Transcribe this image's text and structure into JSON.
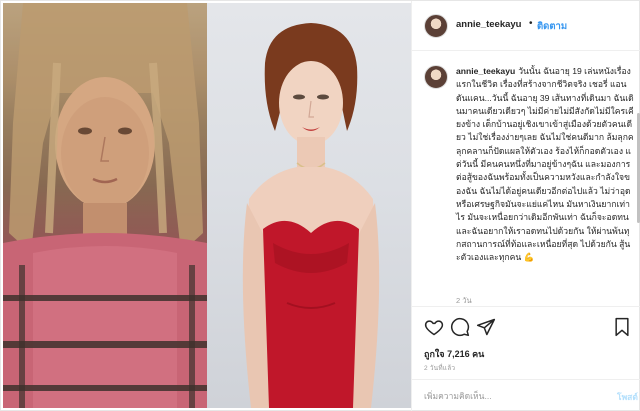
{
  "post": {
    "username": "annie_teekayu",
    "follow_separator": "•",
    "follow_label": "ติดตาม",
    "caption_username": "annie_teekayu",
    "caption_text": "วันนั้น ฉันอายุ 19 เล่นหนังเรื่องแรกในชีวิต เรื่องที่สร้างจากชีวิตจริง เชอรี่ แอน ดันแคน...วันนี้ ฉันอายุ 39 เส้นทางที่เดินมา ฉันเดินมาคนเดียวเดียวๆ ไม่มีค่ายไม่มีสังกัดไม่มีใครเคียงข้าง เด็กบ้านอยู่เชิงเขาเข้าสู่เมืองด้วยตัวคนเดียว ไม่ใช่เรื่องง่ายๆเลย ฉันไม่ใช่คนดีมาก ล้มลุกคลุกคลานก็ปัดแผลให้ตัวเอง ร้องไห้ก็กอดตัวเอง แต่วันนี้ มีคนคนหนึ่งที่มาอยู่ข้างๆฉัน และมองการต่อสู้ของฉันพร้อมทั้งเป็นความหวังและกำลังใจของฉัน ฉันไม่ได้อยู่คนเดียวอีกต่อไปแล้ว ไม่ว่าอุดหรือเศรษฐกิจมันจะแย่แค่ไหน มันหาเงินยากเท่าไร มันจะเหนื่อยกว่าเดิมอีกพันเท่า ฉันก็จะอดทน และฉันอยากให้เราอดทนไปด้วยกัน ให้ผ่านพ้นทุกสถานการณ์ที่ท้อและเหนื่อยที่สุด ไปด้วยกัน สู้นะตัวเองและทุกคน 💪",
    "caption_time": "2 วัน",
    "likes": "ถูกใจ 7,216 คน",
    "post_time": "2 วันที่แล้ว",
    "comment_placeholder": "เพิ่มความคิดเห็น...",
    "comment_post_label": "โพสต์"
  },
  "icons": {
    "like": "heart-icon",
    "comment": "comment-icon",
    "share": "share-icon",
    "save": "bookmark-icon"
  },
  "colors": {
    "follow": "#3897f0",
    "post_disabled": "#b2dffc",
    "dress": "#c0172a"
  }
}
